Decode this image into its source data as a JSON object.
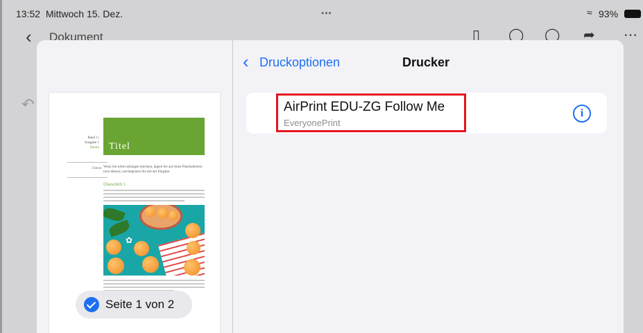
{
  "status_bar": {
    "time": "13:52",
    "date": "Mittwoch 15. Dez.",
    "dots": "•••",
    "wifi_icon": "wifi-icon",
    "battery": "93%"
  },
  "doc_nav": {
    "title": "Dokument",
    "icons": [
      "chevron-left-icon",
      "bookmark-icon",
      "search-icon",
      "comment-icon",
      "share-icon",
      "more-icon"
    ]
  },
  "sheet": {
    "back_label": "Druckoptionen",
    "title": "Drucker",
    "printer": {
      "name": "AirPrint EDU-ZG Follow Me",
      "subtitle": "EveryonePrint"
    },
    "preview": {
      "meta_line1": "Band 1 |",
      "meta_line2": "Ausgabe 1",
      "meta_datum": "Datum",
      "title": "Titel",
      "datum_right": "Datum",
      "intro": "Wenn Sie sofort anfangen möchten, tippen Sie auf einen Platzhaltertext (wie diesen), und beginnen Sie mit der Eingabe.",
      "heading": "Überschrift 1"
    },
    "page_selector": "Seite 1 von 2"
  },
  "colors": {
    "accent": "#1d6ff2",
    "highlight": "#e3141c",
    "doc_green": "#6aa433"
  }
}
